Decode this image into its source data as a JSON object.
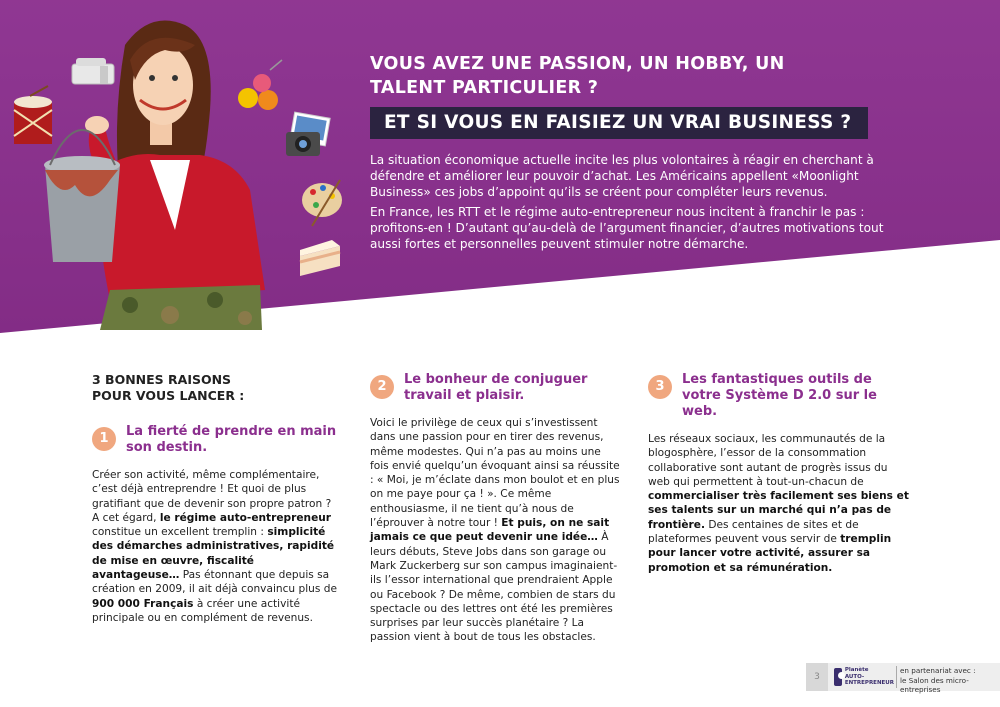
{
  "colors": {
    "brand_purple": "#8b2f8e",
    "dark_box": "#2b2340",
    "number_badge": "#f0a77f"
  },
  "header": {
    "headline_line1": "VOUS AVEZ UNE PASSION, UN HOBBY, UN",
    "headline_line2": "TALENT PARTICULIER ?",
    "headline_box": "ET SI VOUS EN FAISIEZ UN VRAI BUSINESS ?",
    "intro_p1": "La situation économique actuelle incite les plus volontaires à réagir en cherchant à défendre et améliorer leur pouvoir d’achat. Les Américains appellent «Moonlight Business» ces jobs d’appoint qu’ils se créent pour compléter leurs revenus.",
    "intro_p2": "En France, les RTT et le régime auto-entrepreneur nous incitent à franchir le pas : profitons-en ! D’autant qu’au-delà de l’argument financier, d’autres motivations tout aussi fortes et personnelles peuvent stimuler notre démarche."
  },
  "illustration": {
    "icons": [
      "sewing-machine-icon",
      "drum-icon",
      "yarn-balls-icon",
      "camera-photos-icon",
      "paint-palette-icon",
      "cake-icon",
      "paint-bucket-icon"
    ]
  },
  "reasons": {
    "title_line1": "3 BONNES RAISONS",
    "title_line2": "POUR VOUS LANCER :",
    "r1": {
      "number": "1",
      "title": "La fierté de prendre en main son destin.",
      "t1": "Créer son activité, même complémentaire, c’est déjà entreprendre ! Et quoi de plus gratifiant que de devenir son propre patron ?",
      "t2": "A cet égard,",
      "b1": "le régime auto-entrepreneur",
      "t3": "constitue un excellent tremplin :",
      "b2": "simplicité des démarches administratives, rapidité de mise en œuvre, fiscalité avantageuse…",
      "t4": "Pas étonnant que depuis sa création en 2009, il ait déjà convaincu plus de",
      "b3": "900 000 Français",
      "t5": "à créer une activité principale ou en complément de revenus."
    },
    "r2": {
      "number": "2",
      "title": "Le bonheur de conjuguer travail et plaisir.",
      "t1": "Voici le privilège de ceux qui s’investissent dans une passion pour en tirer des revenus, même modestes. Qui n’a pas au moins une fois envié quelqu’un évoquant ainsi sa réussite : « Moi, je m’éclate dans mon boulot et en plus on me paye pour ça ! ». Ce même enthousiasme, il ne tient qu’à nous de l’éprouver à notre tour !",
      "b1": "Et puis, on ne sait jamais ce que peut devenir une idée…",
      "t2": "À leurs débuts, Steve Jobs dans son garage ou Mark Zuckerberg sur son campus imaginaient-ils l’essor international que prendraient Apple ou Facebook ? De même, combien de stars du spectacle ou des lettres ont été les premières surprises par leur succès planétaire ? La passion vient à bout de tous les obstacles."
    },
    "r3": {
      "number": "3",
      "title": "Les fantastiques outils de votre Système D 2.0 sur le web.",
      "t1": "Les réseaux sociaux, les communautés de la blogosphère, l’essor de la consommation collaborative sont autant de progrès issus du web qui permettent à tout-un-chacun de",
      "b1": "commercialiser très facilement ses biens et ses talents sur un marché qui n’a pas de frontière.",
      "t2": "Des centaines de sites et de plateformes peuvent vous servir de",
      "b2": "tremplin pour lancer votre activité, assurer sa promotion et sa rémunération."
    }
  },
  "footer": {
    "page_number": "3",
    "logo_line1": "Planète",
    "logo_line2": "AUTO-ENTREPRENEUR",
    "partner_line1": "en partenariat avec :",
    "partner_line2": "le Salon des micro-entreprises"
  }
}
